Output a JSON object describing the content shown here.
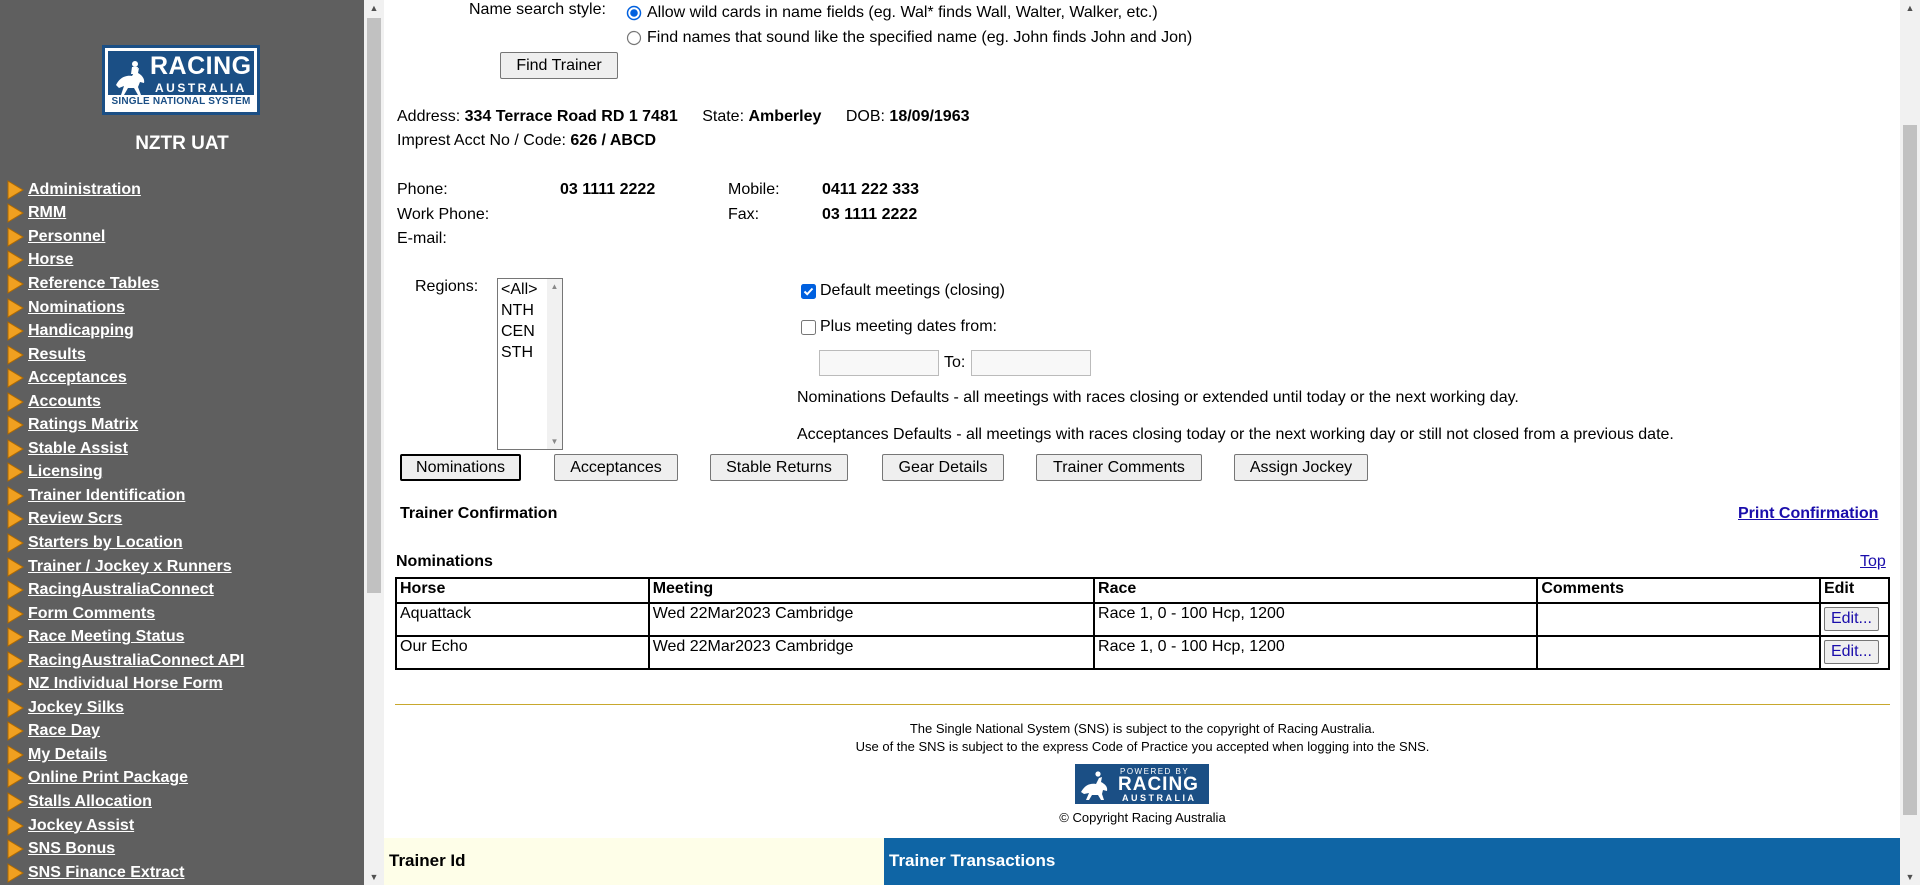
{
  "sidebar": {
    "logo": {
      "line1": "RACING",
      "line2": "AUSTRALIA",
      "line3": "SINGLE NATIONAL SYSTEM"
    },
    "env_title": "NZTR UAT",
    "items": [
      "Administration",
      "RMM",
      "Personnel",
      "Horse",
      "Reference Tables",
      "Nominations",
      "Handicapping",
      "Results",
      "Acceptances",
      "Accounts",
      "Ratings Matrix",
      "Stable Assist",
      "Licensing",
      "Trainer Identification",
      "Review Scrs",
      "Starters by Location",
      "Trainer / Jockey x Runners",
      "RacingAustraliaConnect",
      "Form Comments",
      "Race Meeting Status",
      "RacingAustraliaConnect API",
      "NZ Individual Horse Form",
      "Jockey Silks",
      "Race Day",
      "My Details",
      "Online Print Package",
      "Stalls Allocation",
      "Jockey Assist",
      "SNS Bonus",
      "SNS Finance Extract"
    ],
    "arrow_color": "#f0a020"
  },
  "search": {
    "style_label": "Name search style:",
    "option_wildcard": "Allow wild cards in name fields (eg. Wal* finds Wall, Walter, Walker, etc.)",
    "option_soundex": "Find names that sound like the specified name (eg. John finds John and Jon)",
    "selected_option": "wildcard",
    "find_button": "Find Trainer"
  },
  "trainer": {
    "address_label": "Address:",
    "address": "334 Terrace Road RD 1 7481",
    "state_label": "State:",
    "state": "Amberley",
    "dob_label": "DOB:",
    "dob": "18/09/1963",
    "imprest_label": "Imprest Acct No / Code:",
    "imprest": "626 / ABCD",
    "phone_label": "Phone:",
    "phone": "03 1111 2222",
    "mobile_label": "Mobile:",
    "mobile": "0411 222 333",
    "work_phone_label": "Work Phone:",
    "work_phone": "",
    "fax_label": "Fax:",
    "fax": "03 1111 2222",
    "email_label": "E-mail:",
    "email": ""
  },
  "filters": {
    "regions_label": "Regions:",
    "regions": [
      "<All>",
      "NTH",
      "CEN",
      "STH"
    ],
    "default_meetings_label": "Default meetings (closing)",
    "default_meetings_checked": true,
    "plus_dates_label": "Plus meeting dates from:",
    "plus_dates_checked": false,
    "to_label": "To:",
    "from_value": "",
    "to_value": "",
    "nominations_note": "Nominations Defaults - all meetings with races closing or extended until today or the next working day.",
    "acceptances_note": "Acceptances Defaults - all meetings with races closing today or the next working day or still not closed from a previous date."
  },
  "tabs": [
    {
      "label": "Nominations",
      "active": true
    },
    {
      "label": "Acceptances",
      "active": false
    },
    {
      "label": "Stable Returns",
      "active": false
    },
    {
      "label": "Gear Details",
      "active": false
    },
    {
      "label": "Trainer Comments",
      "active": false
    },
    {
      "label": "Assign Jockey",
      "active": false
    }
  ],
  "confirmation": {
    "title": "Trainer Confirmation",
    "print_link": "Print Confirmation",
    "section_title": "Nominations",
    "top_link": "Top",
    "columns": [
      "Horse",
      "Meeting",
      "Race",
      "Comments",
      "Edit"
    ],
    "rows": [
      {
        "horse": "Aquattack",
        "meeting": "Wed 22Mar2023 Cambridge",
        "race": "Race 1, 0 - 100 Hcp, 1200",
        "comments": "",
        "edit": "Edit..."
      },
      {
        "horse": "Our Echo",
        "meeting": "Wed 22Mar2023 Cambridge",
        "race": "Race 1, 0 - 100 Hcp, 1200",
        "comments": "",
        "edit": "Edit..."
      }
    ]
  },
  "footer": {
    "line1": "The Single National System (SNS) is subject to the copyright of Racing Australia.",
    "line2": "Use of the SNS is subject to the express Code of Practice you accepted when logging into the SNS.",
    "logo_top": "POWERED BY",
    "logo_mid": "RACING",
    "logo_bottom": "AUSTRALIA",
    "copyright": "© Copyright Racing Australia"
  },
  "bottom_bar": {
    "left_label": "Trainer Id",
    "right_label": "Trainer Transactions"
  },
  "colors": {
    "sidebar_bg": "#5f5f5f",
    "brand_blue": "#1b4f85",
    "link": "#1a0dab",
    "bottom_bar_blue": "#0f65a5"
  }
}
